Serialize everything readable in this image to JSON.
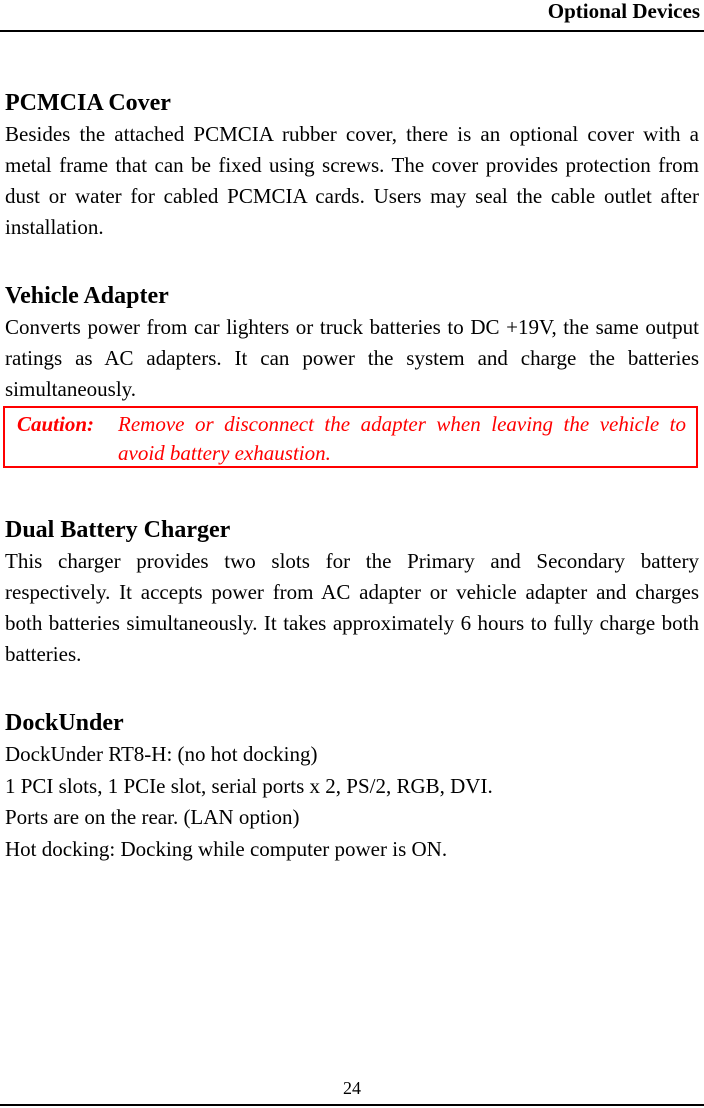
{
  "header": {
    "title": "Optional Devices"
  },
  "sections": [
    {
      "heading": "PCMCIA Cover",
      "body": "Besides the attached PCMCIA rubber cover, there is an optional cover with a metal frame that can be fixed using screws. The cover provides protection from dust or water for cabled PCMCIA cards. Users may seal the cable outlet after installation."
    },
    {
      "heading": "Vehicle Adapter",
      "body": "Converts power from car lighters or truck batteries to DC +19V, the same output ratings as AC adapters. It can power the system and charge the batteries simultaneously."
    },
    {
      "heading": "Dual Battery Charger",
      "body": "This charger provides two slots for the Primary and Secondary battery respectively. It accepts power from AC adapter or vehicle adapter and charges both batteries simultaneously. It takes approximately 6 hours to fully charge both batteries."
    },
    {
      "heading": "DockUnder",
      "lines": [
        "DockUnder RT8-H: (no hot docking)",
        "1 PCI slots, 1 PCIe slot, serial ports x 2, PS/2, RGB, DVI.",
        "Ports are on the rear. (LAN option)",
        "Hot docking: Docking while computer power is ON."
      ]
    }
  ],
  "caution": {
    "label": "Caution:",
    "text": "Remove or disconnect the adapter when leaving the vehicle to avoid battery exhaustion.",
    "color": "#ff0000"
  },
  "footer": {
    "page_number": "24"
  }
}
